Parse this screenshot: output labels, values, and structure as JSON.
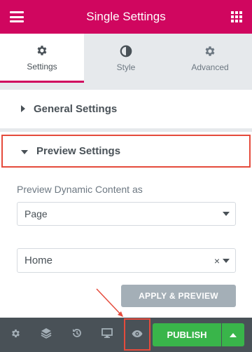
{
  "header": {
    "title": "Single Settings"
  },
  "tabs": [
    {
      "label": "Settings",
      "icon": "gear-icon"
    },
    {
      "label": "Style",
      "icon": "half-circle-icon"
    },
    {
      "label": "Advanced",
      "icon": "gear-icon"
    }
  ],
  "sections": {
    "general": {
      "label": "General Settings"
    },
    "preview": {
      "label": "Preview Settings"
    }
  },
  "preview": {
    "field_label": "Preview Dynamic Content as",
    "select1_value": "Page",
    "select2_value": "Home",
    "clear_symbol": "×",
    "apply_label": "APPLY & PREVIEW"
  },
  "footer": {
    "publish_label": "PUBLISH",
    "icons": [
      "gear-icon",
      "layers-icon",
      "history-icon",
      "desktop-icon",
      "eye-icon"
    ]
  },
  "colors": {
    "brand": "#d0065f",
    "publish": "#39b54a",
    "highlight": "#e54b3c",
    "footer": "#495157"
  }
}
